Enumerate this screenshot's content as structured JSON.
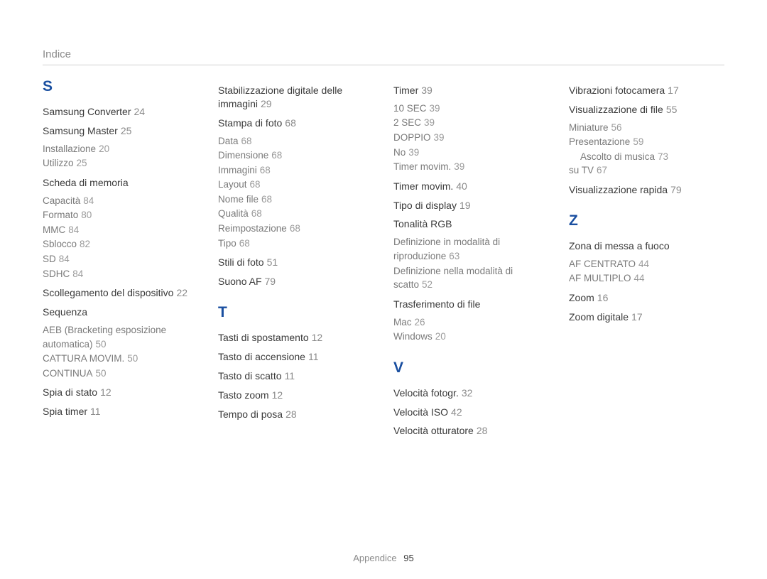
{
  "header": "Indice",
  "footer": {
    "label": "Appendice",
    "page": "95"
  },
  "columns": [
    [
      {
        "type": "letter",
        "text": "S"
      },
      {
        "type": "main",
        "label": "Samsung Converter",
        "page": "24"
      },
      {
        "type": "main",
        "label": "Samsung Master",
        "page": "25"
      },
      {
        "type": "sub",
        "label": "Installazione",
        "page": "20"
      },
      {
        "type": "sub",
        "label": "Utilizzo",
        "page": "25"
      },
      {
        "type": "main",
        "label": "Scheda di memoria",
        "page": ""
      },
      {
        "type": "sub",
        "label": "Capacità",
        "page": "84"
      },
      {
        "type": "sub",
        "label": "Formato",
        "page": "80"
      },
      {
        "type": "sub",
        "label": "MMC",
        "page": "84"
      },
      {
        "type": "sub",
        "label": "Sblocco",
        "page": "82"
      },
      {
        "type": "sub",
        "label": "SD",
        "page": "84"
      },
      {
        "type": "sub",
        "label": "SDHC",
        "page": "84"
      },
      {
        "type": "main",
        "label": "Scollegamento del dispositivo",
        "page": "22"
      },
      {
        "type": "main",
        "label": "Sequenza",
        "page": ""
      },
      {
        "type": "sub",
        "label": "AEB (Bracketing esposizione automatica)",
        "page": "50"
      },
      {
        "type": "sub",
        "label": "CATTURA MOVIM.",
        "page": "50"
      },
      {
        "type": "sub",
        "label": "CONTINUA",
        "page": "50"
      },
      {
        "type": "main",
        "label": "Spia di stato",
        "page": "12"
      },
      {
        "type": "main",
        "label": "Spia timer",
        "page": "11"
      }
    ],
    [
      {
        "type": "main",
        "label": "Stabilizzazione digitale delle immagini",
        "page": "29"
      },
      {
        "type": "main",
        "label": "Stampa di foto",
        "page": "68"
      },
      {
        "type": "sub",
        "label": "Data",
        "page": "68"
      },
      {
        "type": "sub",
        "label": "Dimensione",
        "page": "68"
      },
      {
        "type": "sub",
        "label": "Immagini",
        "page": "68"
      },
      {
        "type": "sub",
        "label": "Layout",
        "page": "68"
      },
      {
        "type": "sub",
        "label": "Nome file",
        "page": "68"
      },
      {
        "type": "sub",
        "label": "Qualità",
        "page": "68"
      },
      {
        "type": "sub",
        "label": "Reimpostazione",
        "page": "68"
      },
      {
        "type": "sub",
        "label": "Tipo",
        "page": "68"
      },
      {
        "type": "main",
        "label": "Stili di foto",
        "page": "51"
      },
      {
        "type": "main",
        "label": "Suono AF",
        "page": "79"
      },
      {
        "type": "letter",
        "text": "T"
      },
      {
        "type": "main",
        "label": "Tasti di spostamento",
        "page": "12"
      },
      {
        "type": "main",
        "label": "Tasto di accensione",
        "page": "11"
      },
      {
        "type": "main",
        "label": "Tasto di scatto",
        "page": "11"
      },
      {
        "type": "main",
        "label": "Tasto zoom",
        "page": "12"
      },
      {
        "type": "main",
        "label": "Tempo di posa",
        "page": "28"
      }
    ],
    [
      {
        "type": "main",
        "label": "Timer",
        "page": "39"
      },
      {
        "type": "sub",
        "label": "10 SEC",
        "page": "39"
      },
      {
        "type": "sub",
        "label": "2 SEC",
        "page": "39"
      },
      {
        "type": "sub",
        "label": "DOPPIO",
        "page": "39"
      },
      {
        "type": "sub",
        "label": "No",
        "page": "39"
      },
      {
        "type": "sub",
        "label": "Timer movim.",
        "page": "39"
      },
      {
        "type": "main",
        "label": "Timer movim.",
        "page": "40"
      },
      {
        "type": "main",
        "label": "Tipo di display",
        "page": "19"
      },
      {
        "type": "main",
        "label": "Tonalità RGB",
        "page": ""
      },
      {
        "type": "sub",
        "label": "Definizione in modalità di riproduzione",
        "page": "63"
      },
      {
        "type": "sub",
        "label": "Definizione nella modalità di scatto",
        "page": "52"
      },
      {
        "type": "main",
        "label": "Trasferimento di file",
        "page": ""
      },
      {
        "type": "sub",
        "label": "Mac",
        "page": "26"
      },
      {
        "type": "sub",
        "label": "Windows",
        "page": "20"
      },
      {
        "type": "letter",
        "text": "V"
      },
      {
        "type": "main",
        "label": "Velocità fotogr.",
        "page": "32"
      },
      {
        "type": "main",
        "label": "Velocità ISO",
        "page": "42"
      },
      {
        "type": "main",
        "label": "Velocità otturatore",
        "page": "28"
      }
    ],
    [
      {
        "type": "main",
        "label": "Vibrazioni fotocamera",
        "page": "17"
      },
      {
        "type": "main",
        "label": "Visualizzazione di file",
        "page": "55"
      },
      {
        "type": "sub",
        "label": "Miniature",
        "page": "56"
      },
      {
        "type": "sub",
        "label": "Presentazione",
        "page": "59"
      },
      {
        "type": "subsub",
        "label": "Ascolto di musica",
        "page": "73"
      },
      {
        "type": "sub",
        "label": "su TV",
        "page": "67"
      },
      {
        "type": "main",
        "label": "Visualizzazione rapida",
        "page": "79"
      },
      {
        "type": "letter",
        "text": "Z"
      },
      {
        "type": "main",
        "label": "Zona di messa a fuoco",
        "page": ""
      },
      {
        "type": "sub",
        "label": "AF CENTRATO",
        "page": "44"
      },
      {
        "type": "sub",
        "label": "AF MULTIPLO",
        "page": "44"
      },
      {
        "type": "main",
        "label": "Zoom",
        "page": "16"
      },
      {
        "type": "main",
        "label": "Zoom digitale",
        "page": "17"
      }
    ]
  ]
}
